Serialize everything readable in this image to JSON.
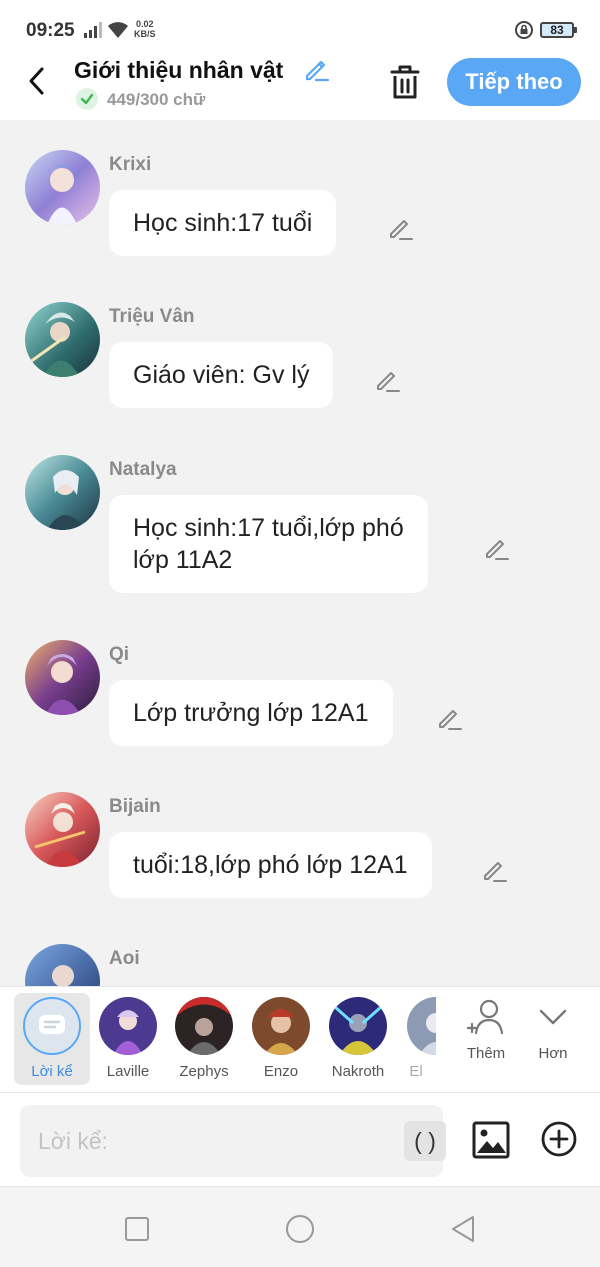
{
  "status_bar": {
    "time": "09:25",
    "speed_value": "0.02",
    "speed_unit": "KB/S",
    "battery": "83"
  },
  "header": {
    "title": "Giới thiệu nhân vật",
    "count": "449/300 chữ",
    "next_label": "Tiếp theo"
  },
  "entries": [
    {
      "name": "Krixi",
      "text": "Học sinh:17 tuổi"
    },
    {
      "name": "Triệu Vân",
      "text": "Giáo viên: Gv lý"
    },
    {
      "name": "Natalya",
      "text_line1": "Học sinh:17 tuổi,lớp phó",
      "text_line2": "lớp 11A2"
    },
    {
      "name": "Qi",
      "text": "Lớp trưởng lớp 12A1"
    },
    {
      "name": "Bijain",
      "text": "tuổi:18,lớp phó lớp 12A1"
    },
    {
      "name": "Aoi",
      "text": ""
    }
  ],
  "character_bar": {
    "narrator_label": "Lời kể",
    "characters": [
      "Laville",
      "Zephys",
      "Enzo",
      "Nakroth",
      "El"
    ],
    "add_label": "Thêm",
    "more_label": "Hơn"
  },
  "input": {
    "placeholder": "Lời kể:",
    "paren_label": "( )"
  },
  "colors": {
    "accent": "#5aa8f5",
    "background": "#f2f2f2",
    "bubble": "#ffffff"
  }
}
